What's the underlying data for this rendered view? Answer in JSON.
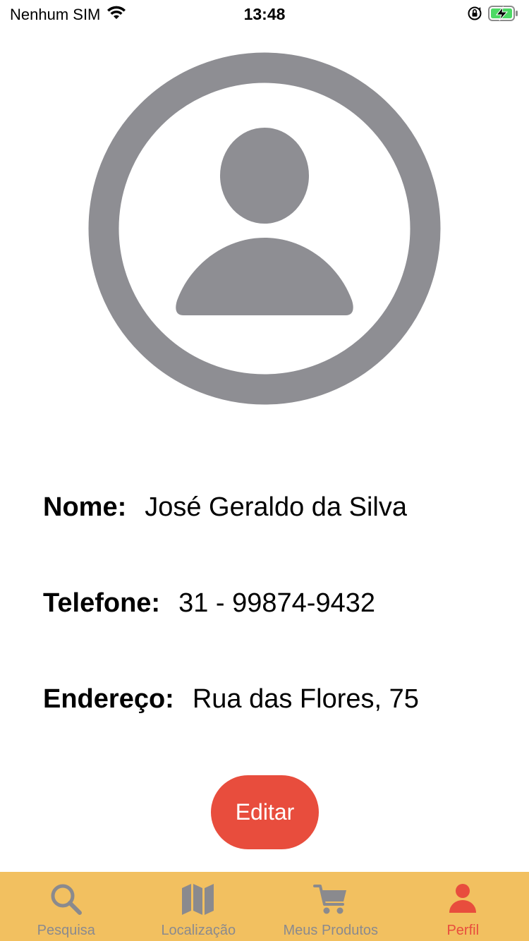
{
  "status_bar": {
    "carrier": "Nenhum SIM",
    "time": "13:48",
    "icons": [
      "wifi-icon",
      "orientation-lock-icon",
      "battery-charging-icon"
    ]
  },
  "profile": {
    "avatar_icon": "person-circle-icon",
    "fields": [
      {
        "label": "Nome:",
        "value": "José Geraldo da Silva"
      },
      {
        "label": "Telefone:",
        "value": "31 - 99874-9432"
      },
      {
        "label": "Endereço:",
        "value": "Rua das Flores, 75"
      }
    ],
    "edit_label": "Editar"
  },
  "tab_bar": {
    "tabs": [
      {
        "label": "Pesquisa",
        "icon": "search-icon",
        "active": false
      },
      {
        "label": "Localização",
        "icon": "map-icon",
        "active": false
      },
      {
        "label": "Meus Produtos",
        "icon": "cart-icon",
        "active": false
      },
      {
        "label": "Perfil",
        "icon": "person-icon",
        "active": true
      }
    ]
  },
  "colors": {
    "accent": "#e84d3d",
    "tab_bar_background": "#f2c060",
    "inactive_gray": "#8a8a8e",
    "battery_green": "#4cd964"
  }
}
